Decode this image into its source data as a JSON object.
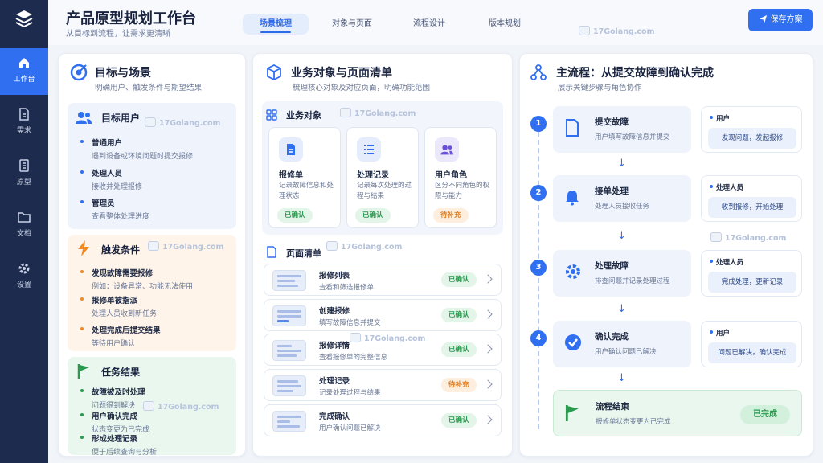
{
  "sidebar": {
    "items": [
      {
        "label": "工作台",
        "icon": "home-icon",
        "active": true
      },
      {
        "label": "需求",
        "icon": "document-icon"
      },
      {
        "label": "原型",
        "icon": "file-list-icon"
      },
      {
        "label": "文档",
        "icon": "folder-icon"
      },
      {
        "label": "设置",
        "icon": "gear-icon"
      }
    ]
  },
  "header": {
    "title": "产品原型规划工作台",
    "subtitle": "从目标到流程，让需求更清晰",
    "tabs": [
      "场景梳理",
      "对象与页面",
      "流程设计",
      "版本规划"
    ],
    "save_label": "保存方案"
  },
  "watermark": "17Golang.com",
  "goals": {
    "title": "目标与场景",
    "subtitle": "明确用户、触发条件与期望结果",
    "users": {
      "title": "目标用户",
      "items": [
        {
          "t": "普通用户",
          "d": "遇到设备或环境问题时提交报修"
        },
        {
          "t": "处理人员",
          "d": "接收并处理报修"
        },
        {
          "t": "管理员",
          "d": "查看整体处理进度"
        }
      ]
    },
    "triggers": {
      "title": "触发条件",
      "items": [
        {
          "t": "发现故障需要报修",
          "d": "例如：设备异常、功能无法使用"
        },
        {
          "t": "报修单被指派",
          "d": "处理人员收到新任务"
        },
        {
          "t": "处理完成后提交结果",
          "d": "等待用户确认"
        }
      ]
    },
    "results": {
      "title": "任务结果",
      "items": [
        {
          "t": "故障被及时处理",
          "d": "问题得到解决"
        },
        {
          "t": "用户确认完成",
          "d": "状态变更为已完成"
        },
        {
          "t": "形成处理记录",
          "d": "便于后续查询与分析"
        }
      ]
    }
  },
  "objects": {
    "title": "业务对象与页面清单",
    "subtitle": "梳理核心对象及对应页面，明确功能范围",
    "section_title": "业务对象",
    "cards": [
      {
        "t": "报修单",
        "d": "记录故障信息和处理状态",
        "status": "已确认"
      },
      {
        "t": "处理记录",
        "d": "记录每次处理的过程与结果",
        "status": "已确认"
      },
      {
        "t": "用户角色",
        "d": "区分不同角色的权限与能力",
        "status": "待补充"
      }
    ],
    "pages_title": "页面清单",
    "pages": [
      {
        "t": "报修列表",
        "d": "查看和筛选报修单",
        "status": "已确认"
      },
      {
        "t": "创建报修",
        "d": "填写故障信息并提交",
        "status": "已确认"
      },
      {
        "t": "报修详情",
        "d": "查看报修单的完整信息",
        "status": "已确认"
      },
      {
        "t": "处理记录",
        "d": "记录处理过程与结果",
        "status": "待补充"
      },
      {
        "t": "完成确认",
        "d": "用户确认问题已解决",
        "status": "已确认"
      }
    ]
  },
  "flow": {
    "title": "主流程：从提交故障到确认完成",
    "subtitle": "展示关键步骤与角色协作",
    "steps": [
      {
        "num": "1",
        "t": "提交故障",
        "d": "用户填写故障信息并提交",
        "role": "用户",
        "action": "发现问题，发起报修"
      },
      {
        "num": "2",
        "t": "接单处理",
        "d": "处理人员接收任务",
        "role": "处理人员",
        "action": "收到报修，开始处理"
      },
      {
        "num": "3",
        "t": "处理故障",
        "d": "排查问题并记录处理过程",
        "role": "处理人员",
        "action": "完成处理，更新记录"
      },
      {
        "num": "4",
        "t": "确认完成",
        "d": "用户确认问题已解决",
        "role": "用户",
        "action": "问题已解决，确认完成"
      }
    ],
    "end": {
      "t": "流程结束",
      "d": "报修单状态变更为已完成",
      "status": "已完成"
    }
  },
  "colors": {
    "accent": "#2f6ff0",
    "sidebar": "#1d2b4e",
    "ok": "#2a9a4f",
    "warn": "#e07b1c"
  }
}
